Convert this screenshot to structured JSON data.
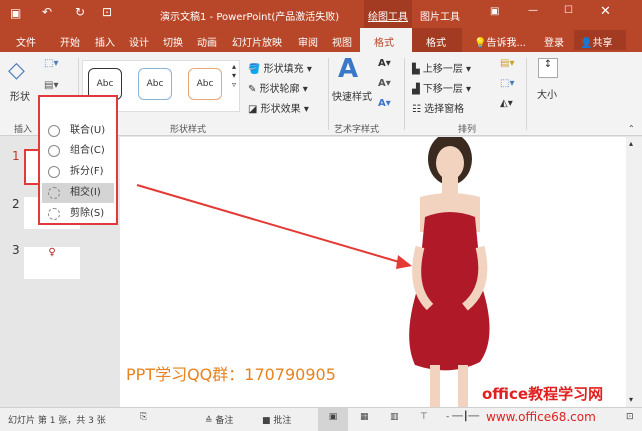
{
  "title": {
    "text": "演示文稿1 - PowerPoint(产品激活失败)",
    "ctx_drawing": "绘图工具",
    "ctx_picture": "图片工具"
  },
  "tabs": [
    "文件",
    "开始",
    "插入",
    "设计",
    "切换",
    "动画",
    "幻灯片放映",
    "审阅",
    "视图",
    "格式",
    "格式"
  ],
  "tell_me": "告诉我...",
  "login": "登录",
  "share": "共享",
  "ribbon": {
    "shape": "形状",
    "insert_group": "插入",
    "abc": [
      "Abc",
      "Abc",
      "Abc"
    ],
    "fill": "形状填充",
    "outline": "形状轮廓",
    "effect": "形状效果",
    "shape_styles": "形状样式",
    "quick_styles": "快速样式",
    "wordart": "艺术字样式",
    "bring_forward": "上移一层",
    "send_backward": "下移一层",
    "selection_pane": "选择窗格",
    "arrange": "排列",
    "size": "大小"
  },
  "menu": {
    "items": [
      "联合(U)",
      "组合(C)",
      "拆分(F)",
      "相交(I)",
      "剪除(S)"
    ]
  },
  "thumbs": [
    "1",
    "2",
    "3"
  ],
  "slide": {
    "text": "PPT学习QQ群：170790905"
  },
  "watermark": {
    "name": "office教程学习网",
    "url": "www.office68.com"
  },
  "status": {
    "slide_info": "幻灯片 第 1 张，共 3 张",
    "notes": "备注",
    "comments": "批注"
  },
  "colors": {
    "accent": "#b8472a",
    "highlight": "#e03a3a",
    "text_orange": "#e8821e"
  }
}
